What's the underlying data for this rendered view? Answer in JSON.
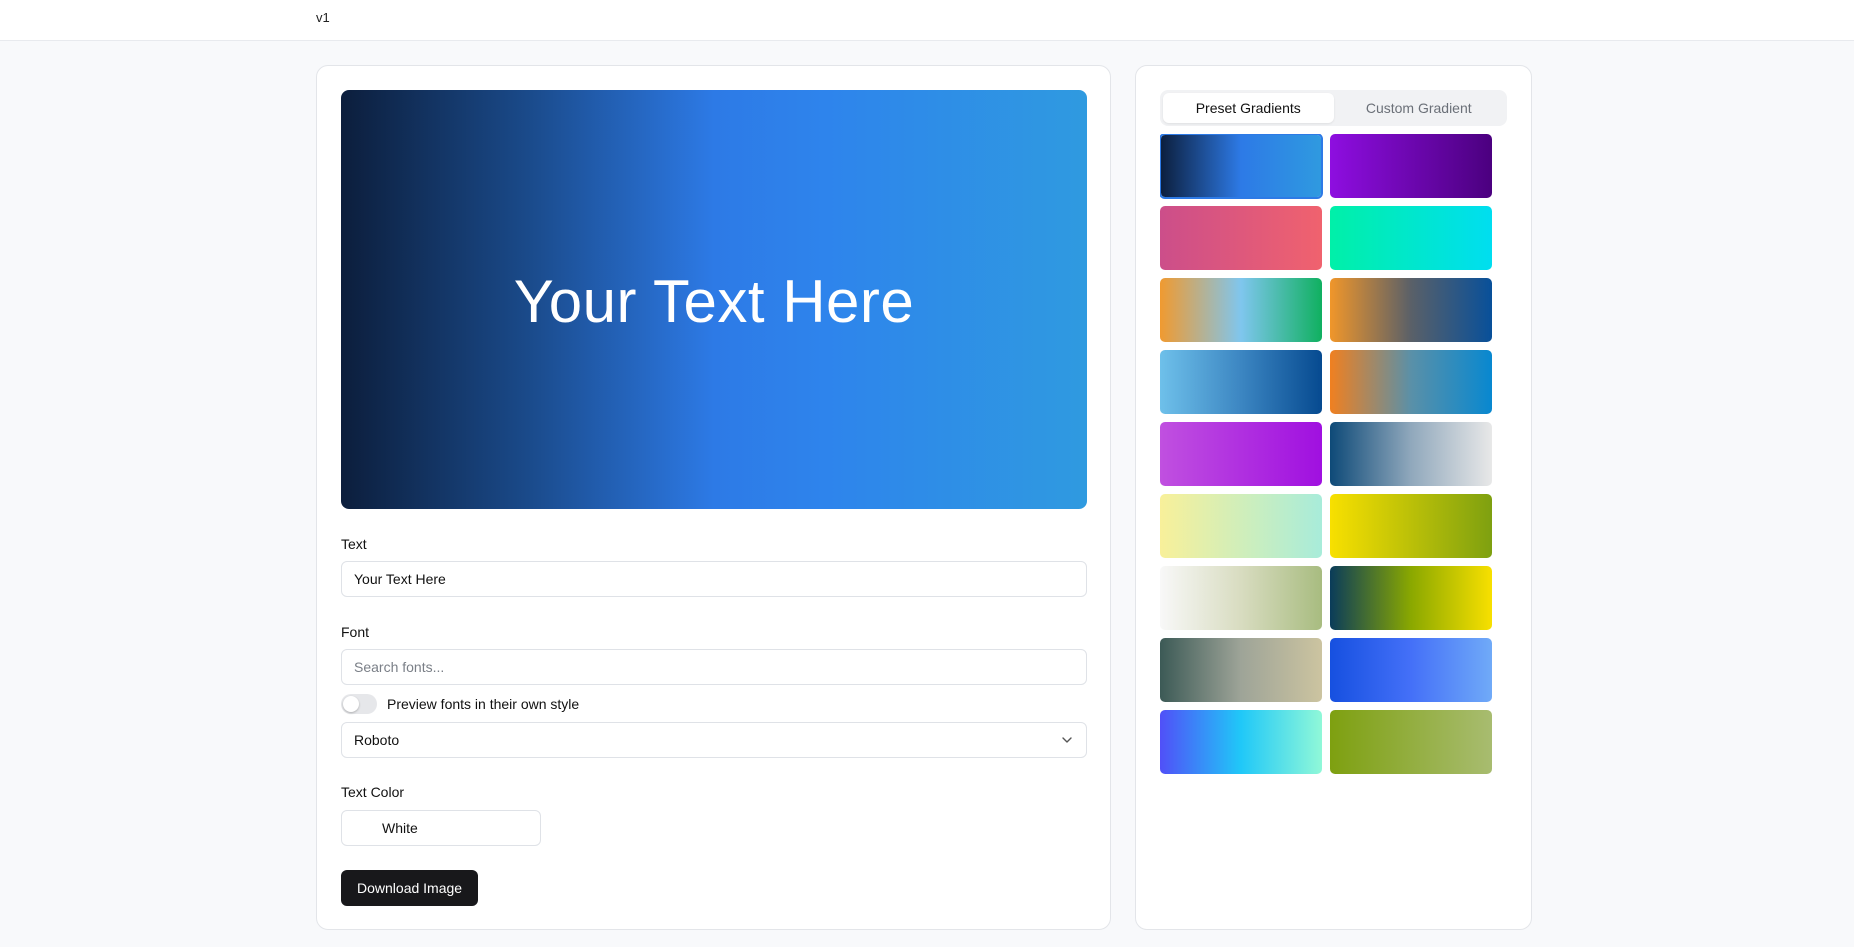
{
  "app": {
    "version": "v1"
  },
  "preview": {
    "text": "Your Text Here"
  },
  "form": {
    "text_label": "Text",
    "text_value": "Your Text Here",
    "font_label": "Font",
    "font_search_placeholder": "Search fonts...",
    "preview_toggle_label": "Preview fonts in their own style",
    "preview_toggle_on": false,
    "font_selected": "Roboto",
    "text_color_label": "Text Color",
    "text_color_value": "White",
    "text_color_hex": "#ffffff",
    "download_label": "Download Image"
  },
  "gradient_panel": {
    "tabs": [
      {
        "label": "Preset Gradients",
        "active": true
      },
      {
        "label": "Custom Gradient",
        "active": false
      }
    ],
    "presets": [
      {
        "colors": [
          "#0c1e3c",
          "#2d7ae6",
          "#2f9ae0"
        ],
        "selected": true
      },
      {
        "colors": [
          "#8e0ee0",
          "#4b007f"
        ]
      },
      {
        "colors": [
          "#cc4e8a",
          "#f0626e"
        ]
      },
      {
        "colors": [
          "#00f0a8",
          "#00def0"
        ]
      },
      {
        "colors": [
          "#f09a30",
          "#7fc6ee",
          "#10b060"
        ]
      },
      {
        "colors": [
          "#f0962a",
          "#5a6068",
          "#08509a"
        ]
      },
      {
        "colors": [
          "#6ec0ea",
          "#3c86c2",
          "#064a90"
        ]
      },
      {
        "colors": [
          "#f08020",
          "#5a90a8",
          "#0888d0"
        ]
      },
      {
        "colors": [
          "#c050e0",
          "#a010e0"
        ]
      },
      {
        "colors": [
          "#0e4a78",
          "#90a8bc",
          "#e8e8e8"
        ]
      },
      {
        "colors": [
          "#f8f09a",
          "#a8ecda"
        ]
      },
      {
        "colors": [
          "#f8e000",
          "#7ea010"
        ]
      },
      {
        "colors": [
          "#f8f8f8",
          "#d8dcc0",
          "#a8bc80"
        ]
      },
      {
        "colors": [
          "#0a3c5a",
          "#8aa800",
          "#f8e000"
        ]
      },
      {
        "colors": [
          "#3c5a56",
          "#9ea498",
          "#ccc4a0"
        ]
      },
      {
        "colors": [
          "#1650e0",
          "#4470f8",
          "#70aaf8"
        ]
      },
      {
        "colors": [
          "#5050f8",
          "#20c8f8",
          "#90f8d8"
        ]
      },
      {
        "colors": [
          "#7ea010",
          "#a8bc70"
        ]
      }
    ]
  }
}
